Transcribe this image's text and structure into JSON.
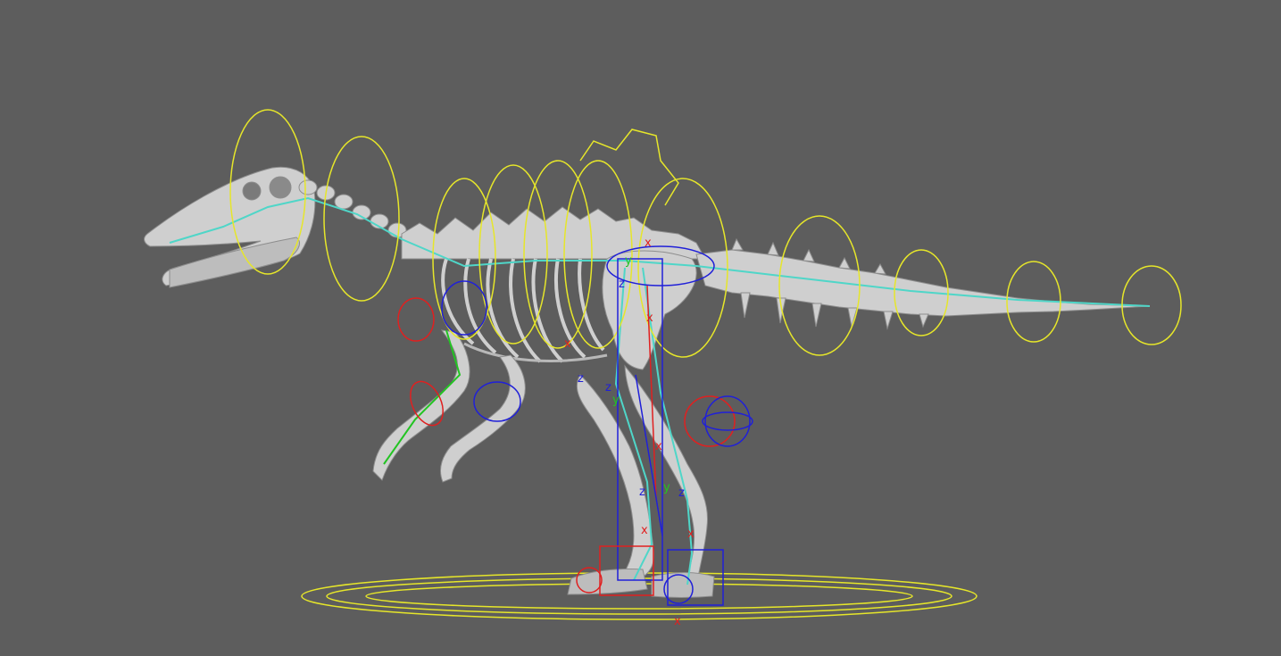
{
  "viewport": {
    "background": "#5d5d5d",
    "subject": "dinosaur-skeleton-rig"
  },
  "colors": {
    "bone": "#cfcfcf",
    "bone_shadow": "#9a9a9a",
    "control_yellow": "#e6e62a",
    "control_red": "#e02020",
    "control_blue": "#2020d8",
    "control_green": "#22c422",
    "joint_cyan": "#4fd6c8"
  },
  "axis_labels": {
    "x": "x",
    "y": "y",
    "z": "z"
  }
}
